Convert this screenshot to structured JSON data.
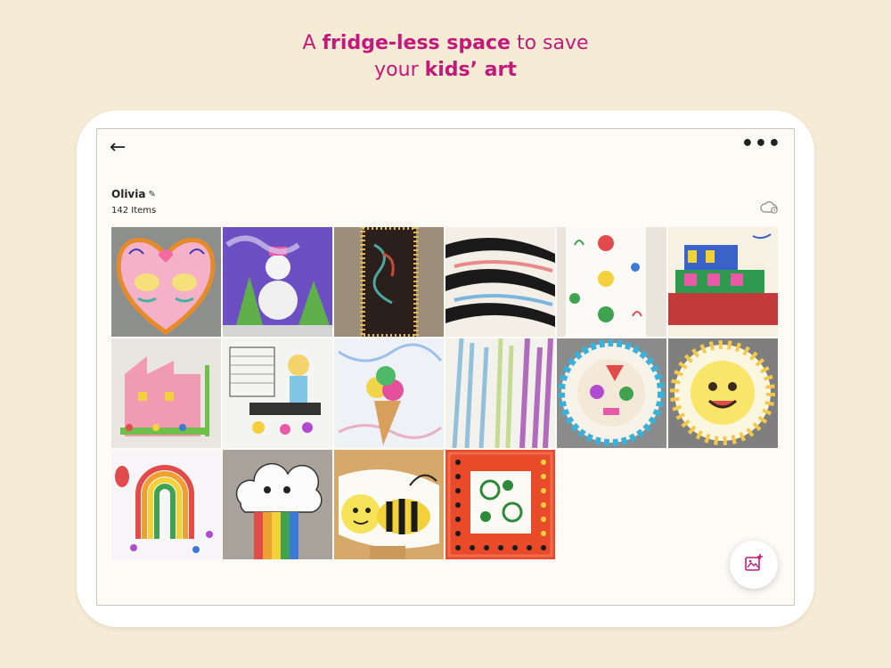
{
  "headline": {
    "part1": "A ",
    "bold1": "fridge-less space",
    "part2": " to save",
    "part3": "your ",
    "bold2": "kids’ art"
  },
  "toolbar": {
    "back_icon": "arrow-left-icon",
    "back_glyph": "←",
    "more_icon": "more-horizontal-icon",
    "more_glyph": "•••"
  },
  "album": {
    "name": "Olivia",
    "item_count": "142 Items",
    "edit_icon": "pencil-icon",
    "sync_icon": "cloud-sync-icon"
  },
  "gallery": {
    "tiles": [
      {
        "name": "heart-drawing-tile"
      },
      {
        "name": "snowman-painting-tile"
      },
      {
        "name": "dark-bookmark-tile"
      },
      {
        "name": "striped-collage-tile"
      },
      {
        "name": "monster-drawings-tile"
      },
      {
        "name": "building-drawing-tile"
      },
      {
        "name": "pink-house-tile"
      },
      {
        "name": "activity-sheet-tile"
      },
      {
        "name": "ice-cream-tile"
      },
      {
        "name": "crayon-scribble-tile"
      },
      {
        "name": "paper-plate-face-tile"
      },
      {
        "name": "sun-plate-tile"
      },
      {
        "name": "rainbow-painting-tile"
      },
      {
        "name": "cloud-rainbow-tile"
      },
      {
        "name": "bee-handprint-tile"
      },
      {
        "name": "framed-dots-tile"
      }
    ]
  },
  "fab": {
    "icon": "add-photo-icon"
  },
  "colors": {
    "background": "#f6ecd6",
    "accent": "#c2197a",
    "screen": "#fcfbf6"
  }
}
